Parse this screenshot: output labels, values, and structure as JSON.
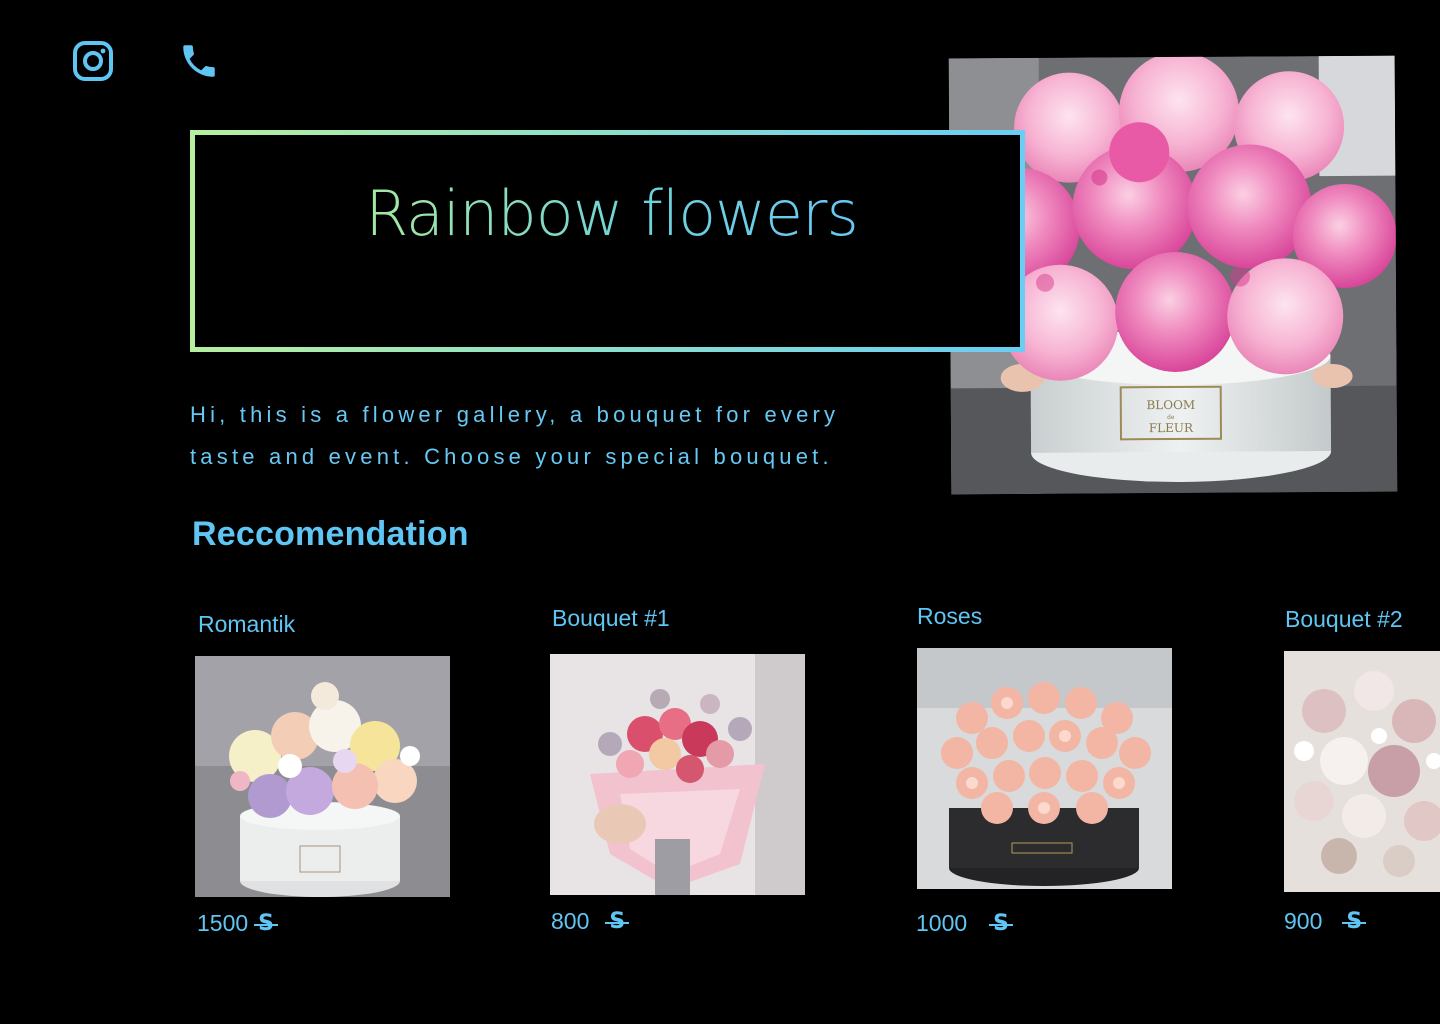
{
  "header": {
    "icons": [
      {
        "name": "instagram-icon"
      },
      {
        "name": "phone-icon"
      }
    ]
  },
  "hero": {
    "title": "Rainbow flowers",
    "intro_line1": "Hi, this is a flower gallery, a bouquet for every",
    "intro_line2": "taste and event. Choose your special bouquet.",
    "box_text_1": "BLOOM",
    "box_text_2": "de",
    "box_text_3": "FLEUR"
  },
  "recommendation": {
    "title": "Reccomendation",
    "currency_symbol": "S",
    "items": [
      {
        "name": "Romantik",
        "price": "1500"
      },
      {
        "name": "Bouquet #1",
        "price": "800"
      },
      {
        "name": "Roses",
        "price": "1000"
      },
      {
        "name": "Bouquet #2",
        "price": "900"
      }
    ]
  },
  "colors": {
    "background": "#000000",
    "accent_blue": "#5fc6f4",
    "accent_green": "#b7ef9f",
    "peony_pink": "#ec6fb0"
  }
}
